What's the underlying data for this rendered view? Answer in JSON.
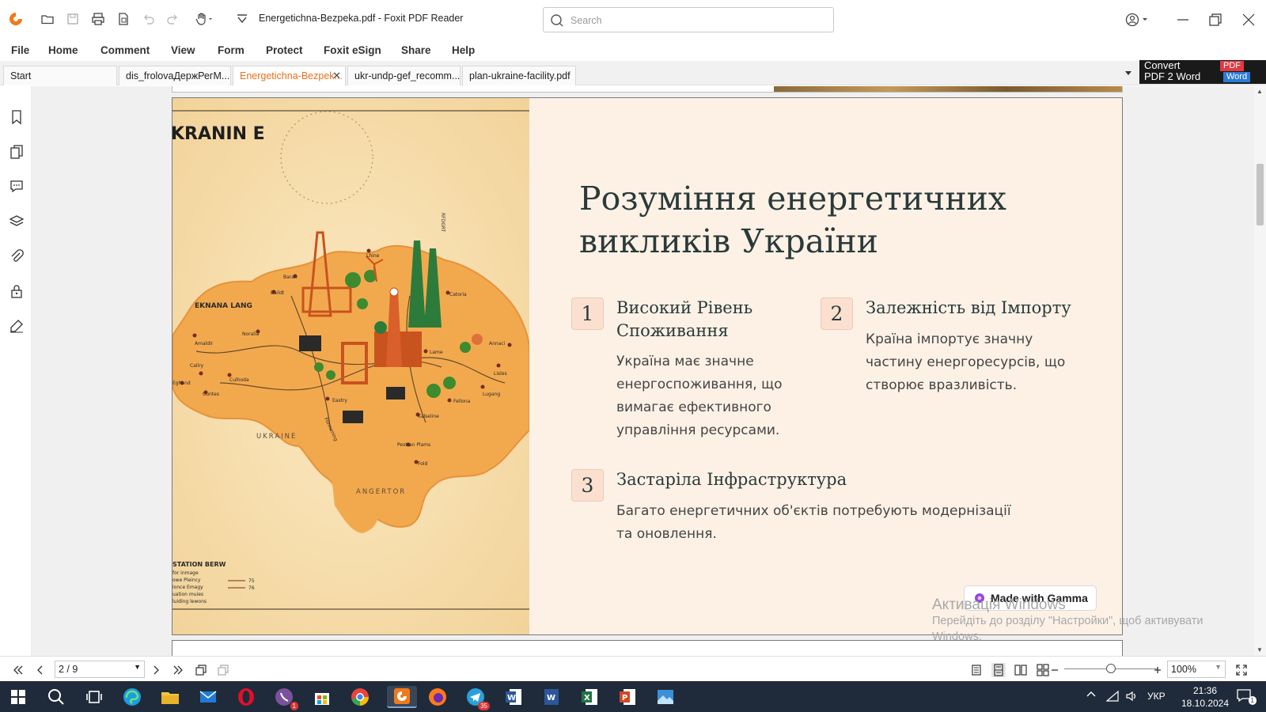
{
  "window": {
    "title": "Energetichna-Bezpeka.pdf - Foxit PDF Reader",
    "search_placeholder": "Search"
  },
  "menu": [
    "File",
    "Home",
    "Comment",
    "View",
    "Form",
    "Protect",
    "Foxit eSign",
    "Share",
    "Help"
  ],
  "tabs": [
    {
      "label": "Start",
      "active": false
    },
    {
      "label": "dis_frolovaДержРегM...",
      "active": false
    },
    {
      "label": "Energetichna-Bezpek...",
      "active": true
    },
    {
      "label": "ukr-undp-gef_recomm...",
      "active": false
    },
    {
      "label": "plan-ukraine-facility.pdf",
      "active": false
    }
  ],
  "convert_ad": {
    "line1": "Convert",
    "line2": "PDF 2 Word",
    "pdf_tag": "PDF",
    "word_tag": "Word"
  },
  "slide": {
    "title": "Розуміння енергетичних викликів України",
    "items": [
      {
        "num": "1",
        "title": "Високий Рівень Споживання",
        "text": "Україна має значне енергоспоживання, що вимагає ефективного управління ресурсами."
      },
      {
        "num": "2",
        "title": "Залежність від Імпорту",
        "text": "Країна імпортує значну частину енергоресурсів, що створює вразливість."
      },
      {
        "num": "3",
        "title": "Застаріла Інфраструктура",
        "text": "Багато енергетичних об'єктів потребують модернізації та оновлення."
      }
    ],
    "gamma_badge": "Made with Gamma",
    "map_labels": {
      "header": "KRANIN E",
      "region_left": "EKNANA LANG",
      "ukraine": "UKRAINE",
      "angertor": "ANGERTOR",
      "legend_title": "STATION BERW",
      "legend_lines": [
        "for inmage",
        "owe Pleincy",
        "ionce Emagy",
        "uation muies",
        "luiding lewons"
      ],
      "legend_vals": [
        "75",
        "76"
      ],
      "cities": [
        "Lhine",
        "Baran",
        "Baildt",
        "Catoria",
        "Noralia",
        "Amaldir",
        "Callry",
        "Culhoda",
        "Eghand",
        "Cuntes",
        "Lame",
        "Annaci",
        "Lisles",
        "Lugang",
        "Fellona",
        "Eastry",
        "Kalseline",
        "Pesttan Plams",
        "Fold",
        "Formening",
        "RFDGRT"
      ]
    }
  },
  "windows_activation": {
    "line1": "Активація Windows",
    "line2": "Перейдіть до розділу \"Настройки\", щоб активувати",
    "line3": "Windows."
  },
  "status": {
    "page": "2 / 9",
    "zoom": "100%"
  },
  "taskbar": {
    "lang": "УКР",
    "time": "21:36",
    "date": "18.10.2024",
    "viber_badge": "1",
    "telegram_badge": "35",
    "notif_count": "1"
  }
}
